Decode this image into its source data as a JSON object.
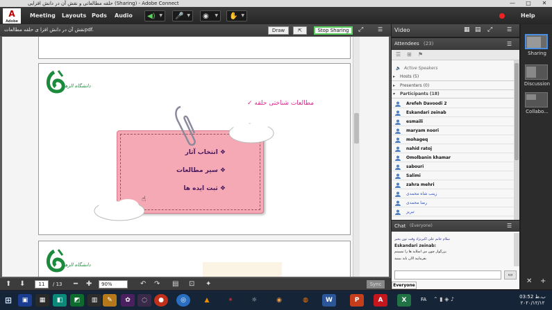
{
  "titlebar": {
    "title": "حلقه مطالعاتی و نقش آن در دانش افزایی (Sharing) - Adobe Connect",
    "minimize": "—",
    "maximize": "□",
    "close": "✕"
  },
  "menubar": {
    "logo_label": "Adobe",
    "items": [
      "Meeting",
      "Layouts",
      "Pods",
      "Audio"
    ],
    "help": "Help"
  },
  "share": {
    "doc_name": "نقش آن در دانش افزا ی حلقه مطالعاتpdf.",
    "draw_label": "Draw",
    "stop_label": "Stop Sharing",
    "page_current": "11",
    "page_total": "/ 13",
    "zoom": "90%",
    "sync_label": "Sync"
  },
  "slide": {
    "logo_text": "دانشگاه الزهرا",
    "heading": "✓ مطالعات شناختی حلقه",
    "bullets": [
      "انتخاب آثار",
      "سیر مطالعات",
      "ثبت ایده ها"
    ]
  },
  "video": {
    "title": "Video"
  },
  "attendees": {
    "title": "Attendees",
    "count": "(23)",
    "active_speakers": "Active Speakers",
    "hosts": "Hosts (5)",
    "presenters": "Presenters (0)",
    "participants": "Participants (18)",
    "list": [
      "Arefeh Davoodi 2",
      "Eskandari zeinab",
      "esmaili",
      "maryam noori",
      "mohageq",
      "nahid ratoj",
      "Omolbanin khamar",
      "sabouri",
      "Salimi",
      "zahra mehri",
      "زینب شاه محمدی",
      "رضا محمدی",
      "تبریز"
    ]
  },
  "chat": {
    "title": "Chat",
    "scope": "(Everyone)",
    "tab": "Everyone",
    "messages": [
      "سلام خانم علی اکبرنژاد وقت تون بخیر",
      "Eskandari zeinab:",
      "بزرگوار چون من اسلاید ها را نمیبینم",
      "بفرمایید الان باید ببینید"
    ]
  },
  "layouts": {
    "items": [
      "Sharing",
      "Discussion",
      "Collabo..."
    ]
  },
  "taskbar": {
    "lang": "FA",
    "time": "03:52 ب.ظ",
    "date": "۲۰۲۰/۱۲/۱۲"
  }
}
